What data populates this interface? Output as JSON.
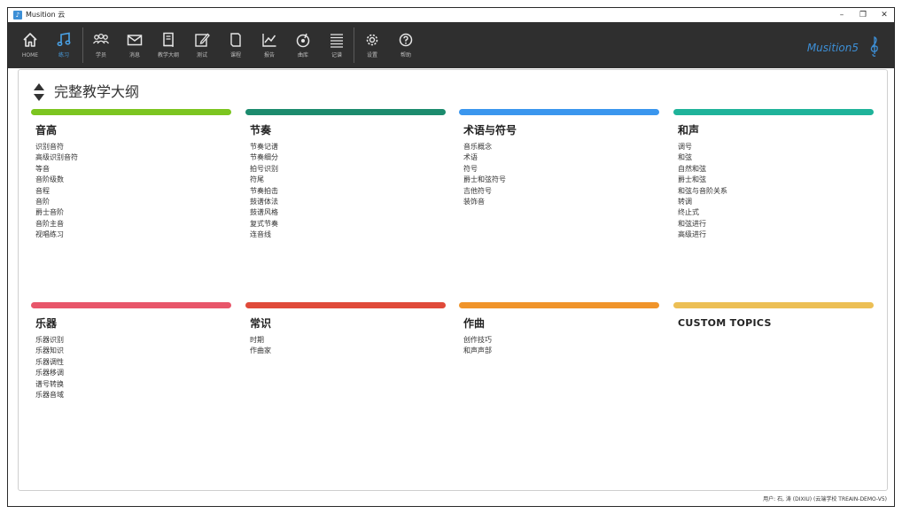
{
  "window": {
    "title": "Musition 云",
    "controls": {
      "minimize": "–",
      "maximize": "❐",
      "close": "✕"
    }
  },
  "toolbar": {
    "items": [
      {
        "label": "HOME",
        "icon": "home-icon"
      },
      {
        "label": "练习",
        "icon": "music-note-icon",
        "active": true
      },
      {
        "label": "学员",
        "icon": "students-icon"
      },
      {
        "label": "消息",
        "icon": "mail-icon"
      },
      {
        "label": "教学大纲",
        "icon": "book-icon"
      },
      {
        "label": "测试",
        "icon": "edit-icon"
      },
      {
        "label": "课程",
        "icon": "document-icon"
      },
      {
        "label": "报告",
        "icon": "chart-icon"
      },
      {
        "label": "曲库",
        "icon": "record-icon"
      },
      {
        "label": "记谱",
        "icon": "list-icon"
      },
      {
        "label": "设置",
        "icon": "gear-icon"
      },
      {
        "label": "帮助",
        "icon": "help-icon"
      }
    ],
    "brand": "Musition5",
    "colors": {
      "background": "#2f2f2f",
      "active": "#4aa3e8",
      "label": "#bdbdbd"
    }
  },
  "page": {
    "title": "完整教学大纲"
  },
  "categories": [
    {
      "title": "音高",
      "color": "#7cc520",
      "items": [
        "识别音符",
        "高级识别音符",
        "等音",
        "音阶级数",
        "音程",
        "音阶",
        "爵士音阶",
        "音阶主音",
        "视唱练习"
      ]
    },
    {
      "title": "节奏",
      "color": "#1c8b6e",
      "items": [
        "节奏记谱",
        "节奏细分",
        "拍号识别",
        "符尾",
        "节奏拍击",
        "鼓谱体法",
        "鼓谱风格",
        "复式节奏",
        "连音线"
      ]
    },
    {
      "title": "术语与符号",
      "color": "#3a96ee",
      "items": [
        "音乐概念",
        "术语",
        "符号",
        "爵士和弦符号",
        "吉他符号",
        "装饰音"
      ]
    },
    {
      "title": "和声",
      "color": "#1fb39a",
      "items": [
        "调号",
        "和弦",
        "自然和弦",
        "爵士和弦",
        "和弦与音阶关系",
        "转调",
        "终止式",
        "和弦进行",
        "高级进行"
      ]
    },
    {
      "title": "乐器",
      "color": "#e8566a",
      "items": [
        "乐器识别",
        "乐器知识",
        "乐器调性",
        "乐器移调",
        "谱号转换",
        "乐器音域"
      ]
    },
    {
      "title": "常识",
      "color": "#e04a3a",
      "items": [
        "时期",
        "作曲家"
      ]
    },
    {
      "title": "作曲",
      "color": "#f0942a",
      "items": [
        "创作技巧",
        "和声声部"
      ]
    },
    {
      "title": "CUSTOM TOPICS",
      "color": "#ecbf55",
      "items": []
    }
  ],
  "status_bar": {
    "text": "用户: 石, 涛 (DIXIU) (云端学校 TREAIN-DEMO-V5)"
  }
}
